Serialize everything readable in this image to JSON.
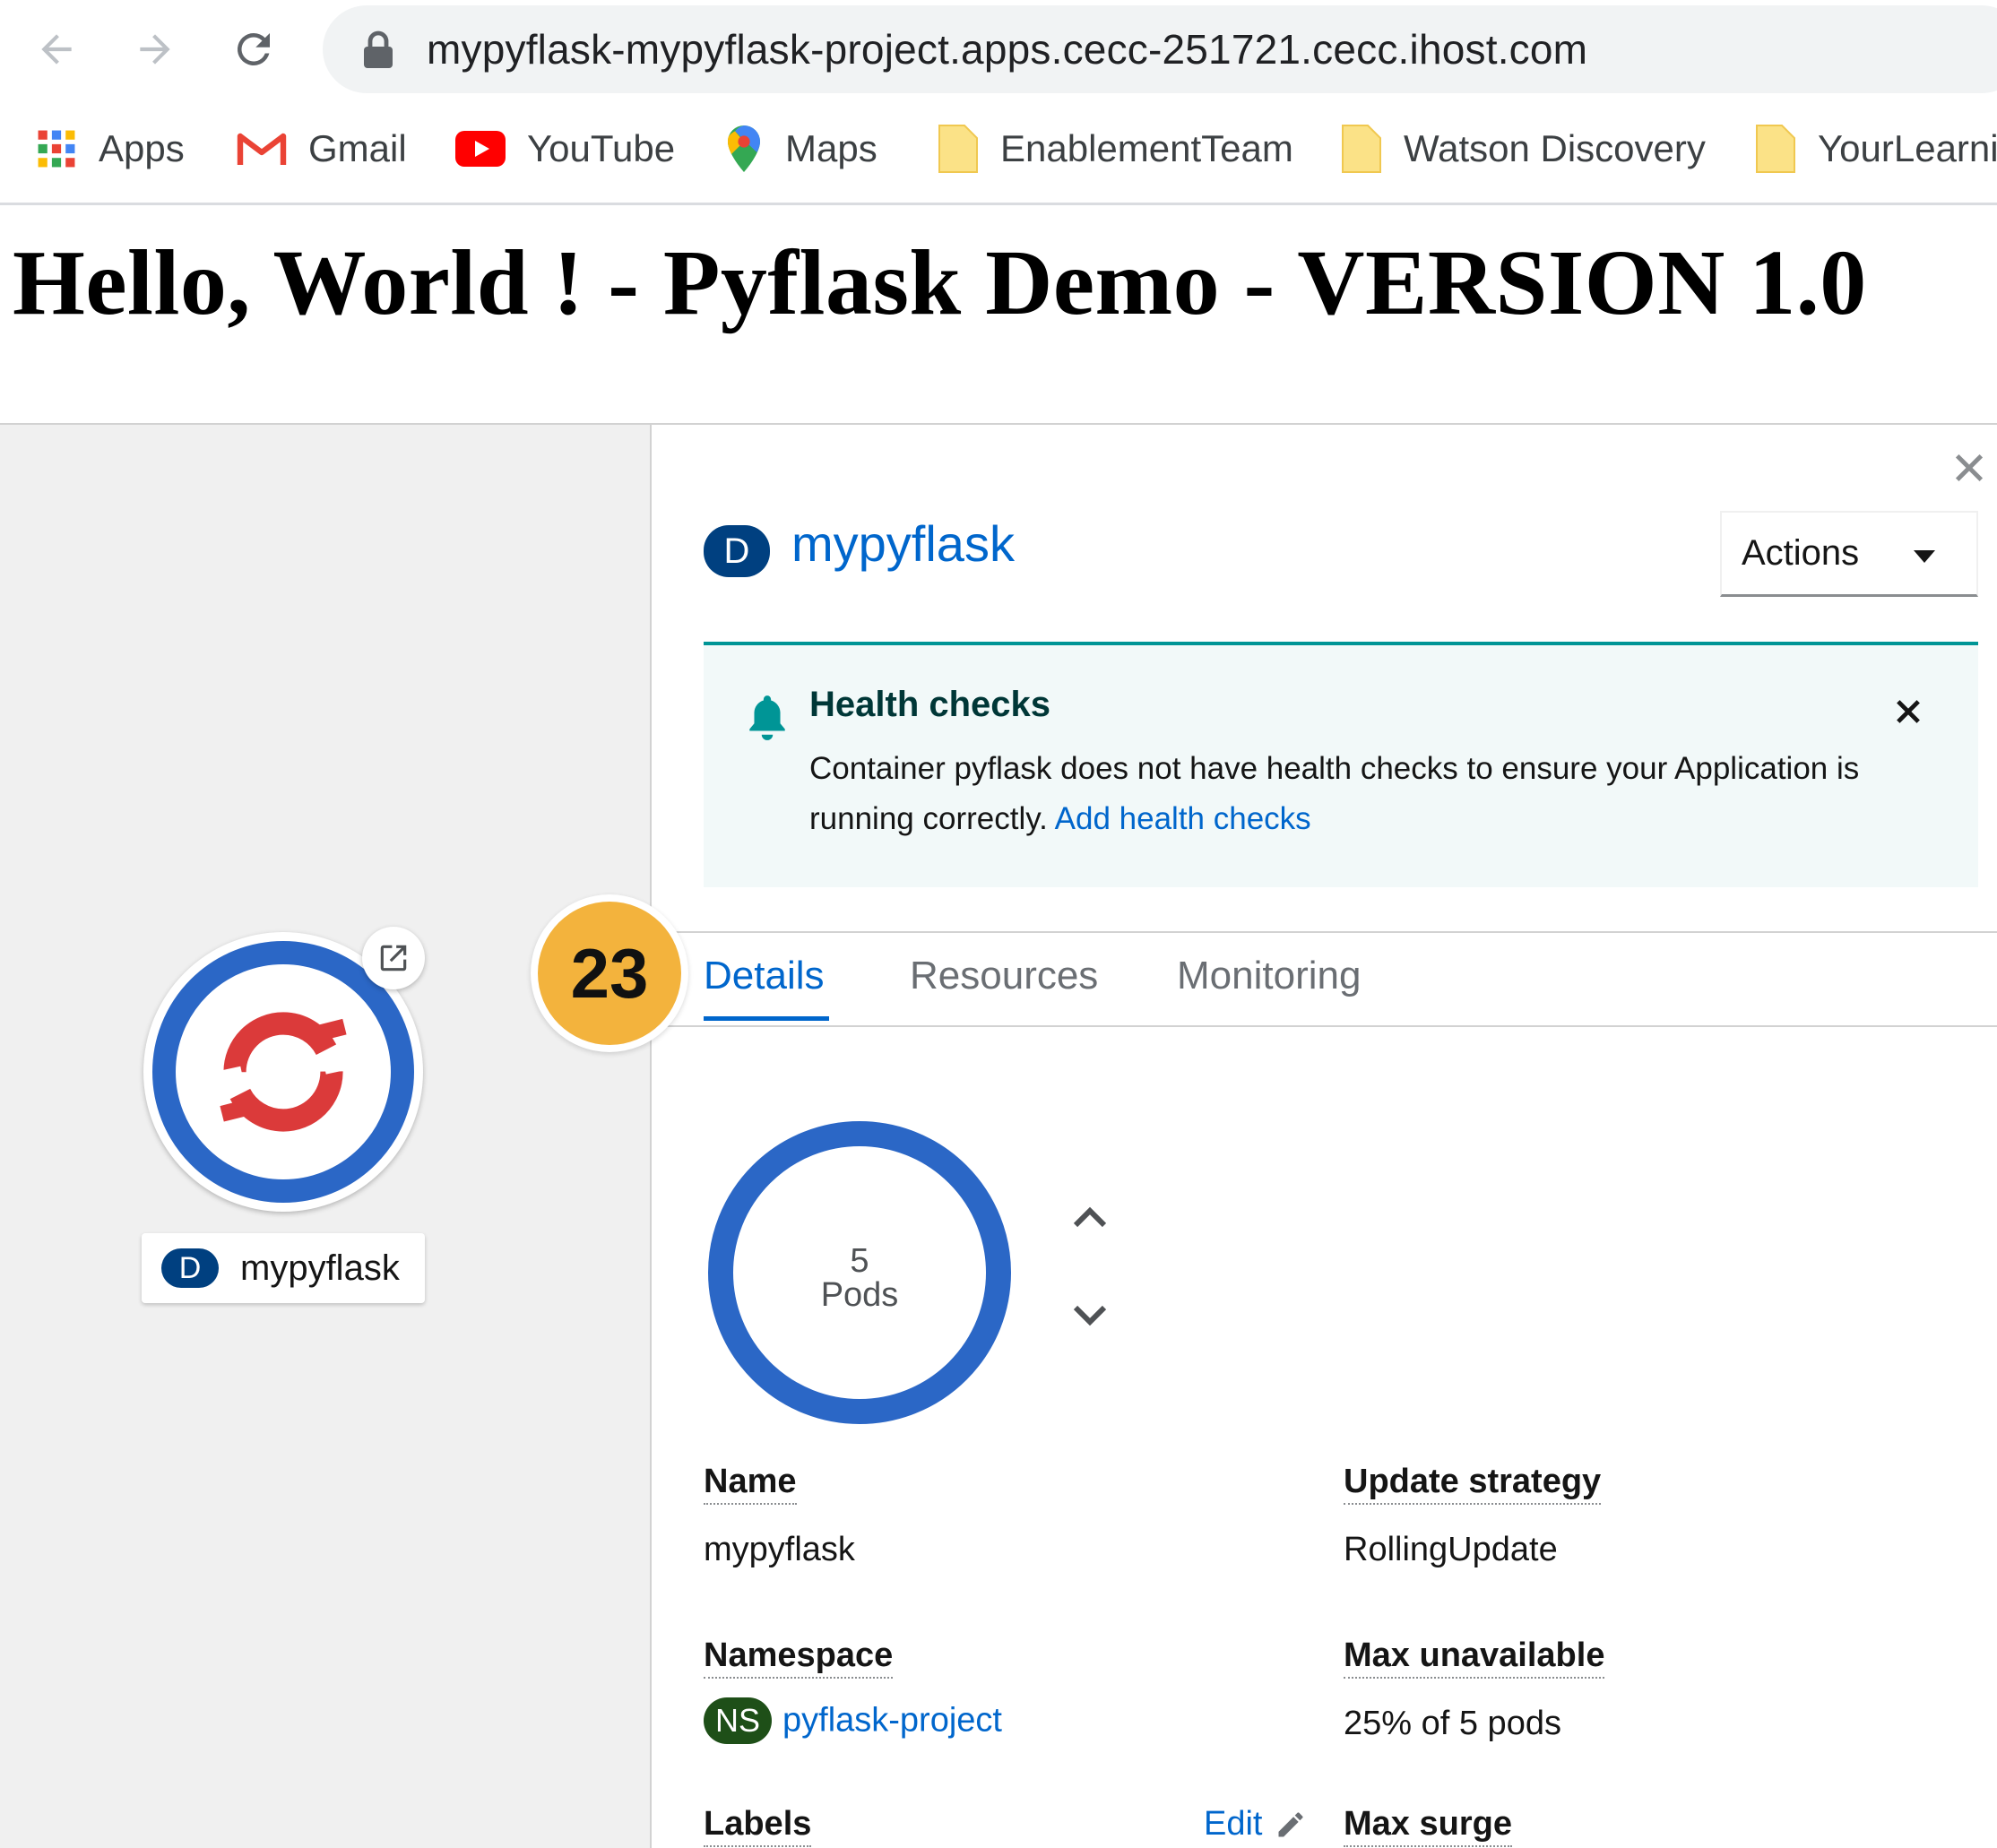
{
  "browser": {
    "url": "mypyflask-mypyflask-project.apps.cecc-251721.cecc.ihost.com",
    "bookmarks": [
      {
        "label": "Apps",
        "icon": "apps-grid-icon"
      },
      {
        "label": "Gmail",
        "icon": "gmail-icon"
      },
      {
        "label": "YouTube",
        "icon": "youtube-icon"
      },
      {
        "label": "Maps",
        "icon": "maps-icon"
      },
      {
        "label": "EnablementTeam",
        "icon": "folder-icon"
      },
      {
        "label": "Watson Discovery",
        "icon": "folder-icon"
      },
      {
        "label": "YourLearni",
        "icon": "folder-icon"
      }
    ]
  },
  "page": {
    "heading": "Hello, World ! - Pyflask Demo - VERSION 1.0"
  },
  "topology": {
    "node_badge": "D",
    "node_label": "mypyflask"
  },
  "panel": {
    "resource_badge": "D",
    "resource_name": "mypyflask",
    "actions_label": "Actions",
    "alert": {
      "title": "Health checks",
      "body": "Container pyflask does not have health checks to ensure your Application is running correctly.",
      "link": "Add health checks"
    },
    "tabs": [
      "Details",
      "Resources",
      "Monitoring"
    ],
    "active_tab": "Details",
    "step_badge": "23",
    "pods": {
      "count": "5",
      "label": "Pods"
    },
    "details": {
      "name_term": "Name",
      "name_value": "mypyflask",
      "namespace_term": "Namespace",
      "namespace_badge": "NS",
      "namespace_value": "pyflask-project",
      "labels_term": "Labels",
      "labels_edit": "Edit",
      "update_strategy_term": "Update strategy",
      "update_strategy_value": "RollingUpdate",
      "max_unavailable_term": "Max unavailable",
      "max_unavailable_value": "25% of 5 pods",
      "max_surge_term": "Max surge"
    }
  },
  "colors": {
    "accent_blue": "#0066cc",
    "node_ring": "#2b67c6",
    "alert_teal": "#009596",
    "step_badge": "#f3b33d",
    "openshift_red": "#db3a3a"
  }
}
